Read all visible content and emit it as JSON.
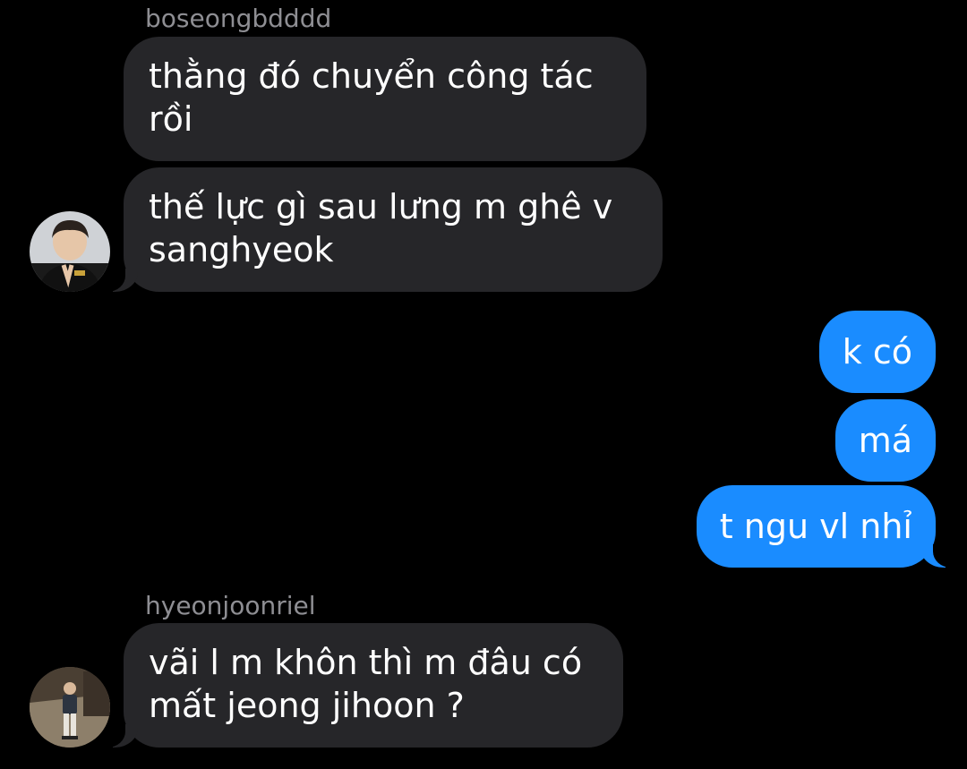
{
  "colors": {
    "background": "#000000",
    "incoming_bubble": "#262629",
    "outgoing_bubble": "#1a8cff",
    "sender_name": "#8e8e93",
    "text": "#ffffff"
  },
  "messages": [
    {
      "sender": "boseongbdddd",
      "direction": "incoming",
      "bubbles": [
        {
          "lines": [
            "thằng đó chuyển công tác",
            "rồi"
          ]
        },
        {
          "lines": [
            "thế lực gì sau lưng m ghê v",
            "sanghyeok"
          ]
        }
      ],
      "avatar_icon": "user-avatar-photo"
    },
    {
      "sender": "",
      "direction": "outgoing",
      "bubbles": [
        {
          "lines": [
            "k có"
          ]
        },
        {
          "lines": [
            "má"
          ]
        },
        {
          "lines": [
            "t ngu vl nhỉ"
          ]
        }
      ]
    },
    {
      "sender": "hyeonjoonriel",
      "direction": "incoming",
      "bubbles": [
        {
          "lines": [
            "vãi l m khôn thì m đâu có",
            "mất jeong jihoon ?"
          ]
        }
      ],
      "avatar_icon": "user-avatar-photo"
    }
  ]
}
